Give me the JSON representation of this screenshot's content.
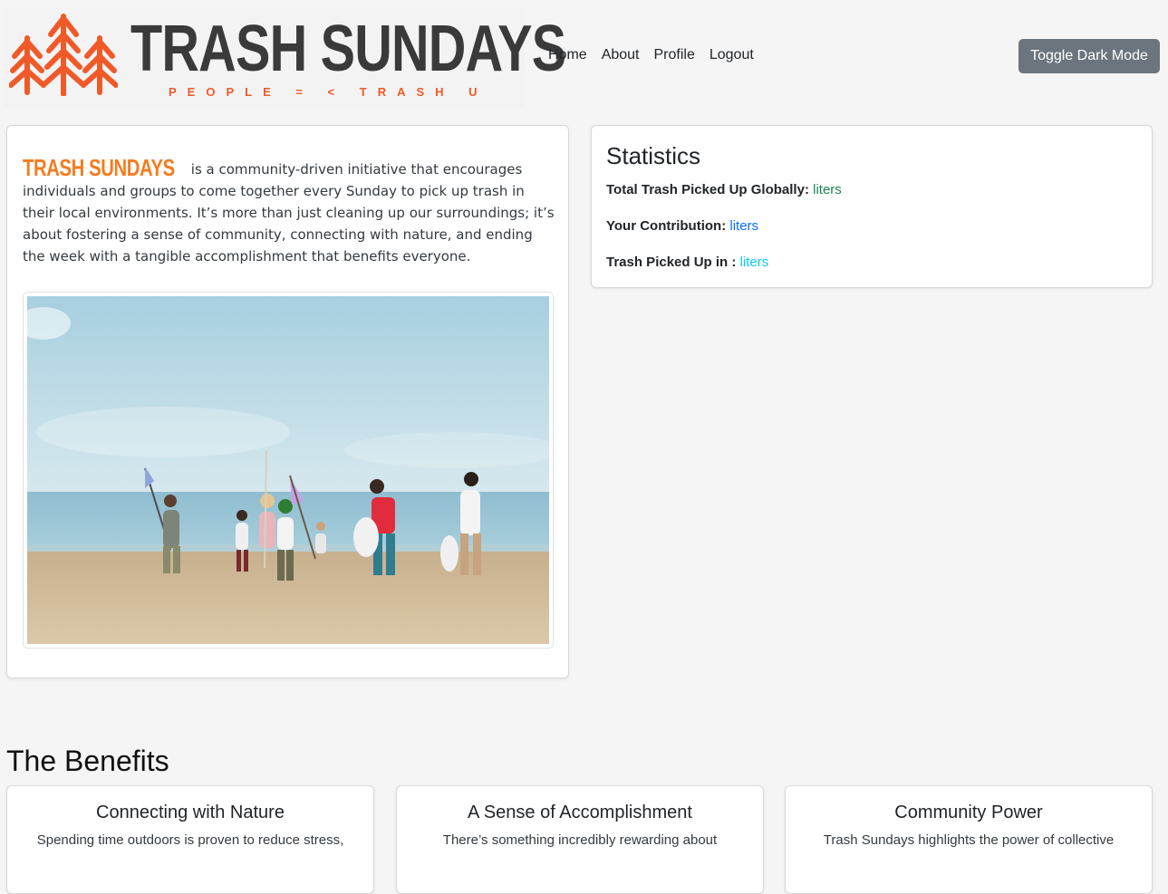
{
  "brand": {
    "title": "TRASH SUNDAYS",
    "tagline": "PEOPLE = < TRASH U",
    "orange": "#f05a28",
    "inline_orange": "#f57c1f"
  },
  "nav": {
    "items": [
      "Home",
      "About",
      "Profile",
      "Logout"
    ]
  },
  "toggle_button": "Toggle Dark Mode",
  "intro": {
    "brand_inline": "TRASH SUNDAYS",
    "text": " is a community-driven initiative that encourages individuals and groups to come together every Sunday to pick up trash in their local environments. It’s more than just cleaning up our surroundings; it’s about fostering a sense of community, connecting with nature, and ending the week with a tangible accomplishment that benefits everyone.",
    "image_alt": "beach-cleanup-photo"
  },
  "stats": {
    "title": "Statistics",
    "rows": [
      {
        "label": "Total Trash Picked Up Globally:",
        "value": "liters",
        "color": "#198754"
      },
      {
        "label": "Your Contribution:",
        "value": "liters",
        "color": "#0d6efd"
      },
      {
        "label": "Trash Picked Up in :",
        "value": "liters",
        "color": "#0dcaf0"
      }
    ]
  },
  "benefits": {
    "heading": "The Benefits",
    "cards": [
      {
        "title": "Connecting with Nature",
        "desc": "Spending time outdoors is proven to reduce stress,"
      },
      {
        "title": "A Sense of Accomplishment",
        "desc": "There’s something incredibly rewarding about"
      },
      {
        "title": "Community Power",
        "desc": "Trash Sundays highlights the power of collective"
      }
    ]
  }
}
